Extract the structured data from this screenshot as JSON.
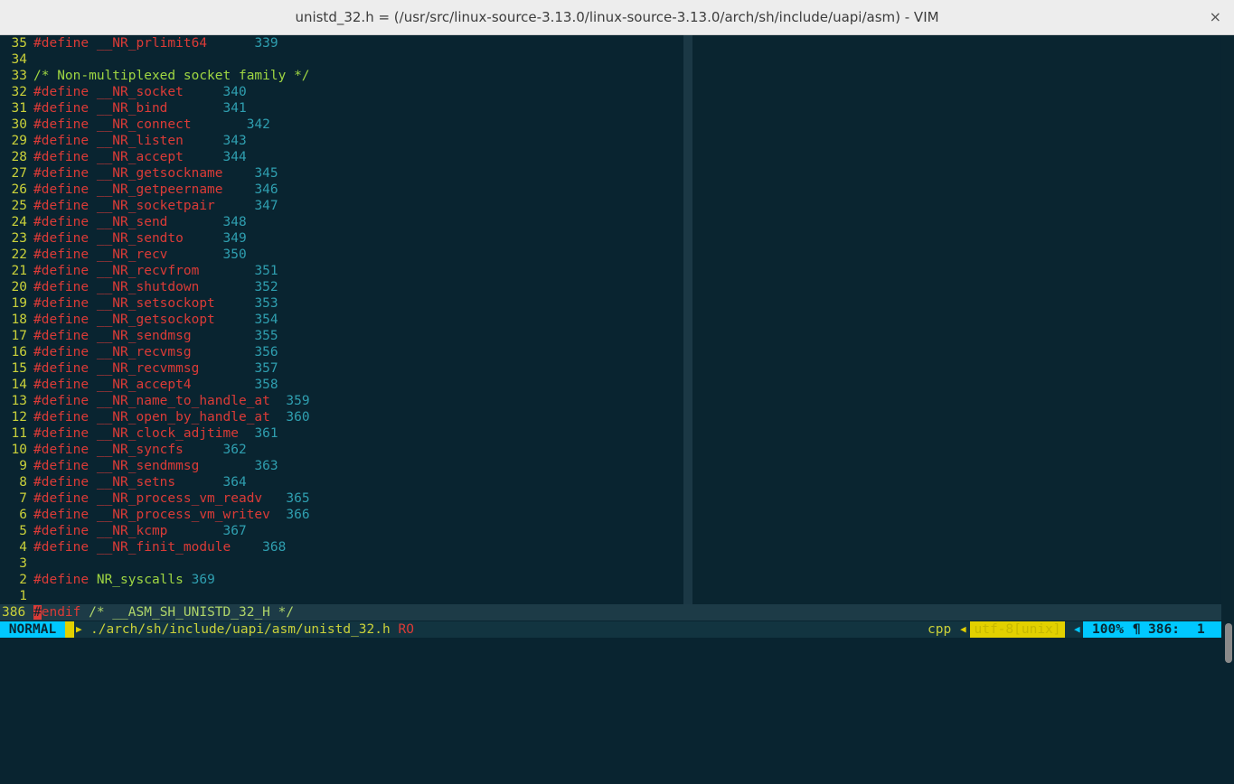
{
  "window": {
    "title": "unistd_32.h = (/usr/src/linux-source-3.13.0/linux-source-3.13.0/arch/sh/include/uapi/asm) - VIM",
    "close_glyph": "×"
  },
  "editor": {
    "lines": [
      {
        "ln": "35",
        "kw": "#define __NR_prlimit64",
        "pad": "      ",
        "num": "339"
      },
      {
        "ln": "34",
        "blank": true
      },
      {
        "ln": "33",
        "comment": "/* Non-multiplexed socket family */"
      },
      {
        "ln": "32",
        "kw": "#define __NR_socket",
        "pad": "     ",
        "num": "340"
      },
      {
        "ln": "31",
        "kw": "#define __NR_bind",
        "pad": "       ",
        "num": "341"
      },
      {
        "ln": "30",
        "kw": "#define __NR_connect",
        "pad": "       ",
        "num": "342"
      },
      {
        "ln": "29",
        "kw": "#define __NR_listen",
        "pad": "     ",
        "num": "343"
      },
      {
        "ln": "28",
        "kw": "#define __NR_accept",
        "pad": "     ",
        "num": "344"
      },
      {
        "ln": "27",
        "kw": "#define __NR_getsockname",
        "pad": "    ",
        "num": "345"
      },
      {
        "ln": "26",
        "kw": "#define __NR_getpeername",
        "pad": "    ",
        "num": "346"
      },
      {
        "ln": "25",
        "kw": "#define __NR_socketpair",
        "pad": "     ",
        "num": "347"
      },
      {
        "ln": "24",
        "kw": "#define __NR_send",
        "pad": "       ",
        "num": "348"
      },
      {
        "ln": "23",
        "kw": "#define __NR_sendto",
        "pad": "     ",
        "num": "349"
      },
      {
        "ln": "22",
        "kw": "#define __NR_recv",
        "pad": "       ",
        "num": "350"
      },
      {
        "ln": "21",
        "kw": "#define __NR_recvfrom",
        "pad": "       ",
        "num": "351"
      },
      {
        "ln": "20",
        "kw": "#define __NR_shutdown",
        "pad": "       ",
        "num": "352"
      },
      {
        "ln": "19",
        "kw": "#define __NR_setsockopt",
        "pad": "     ",
        "num": "353"
      },
      {
        "ln": "18",
        "kw": "#define __NR_getsockopt",
        "pad": "     ",
        "num": "354"
      },
      {
        "ln": "17",
        "kw": "#define __NR_sendmsg",
        "pad": "        ",
        "num": "355"
      },
      {
        "ln": "16",
        "kw": "#define __NR_recvmsg",
        "pad": "        ",
        "num": "356"
      },
      {
        "ln": "15",
        "kw": "#define __NR_recvmmsg",
        "pad": "       ",
        "num": "357"
      },
      {
        "ln": "14",
        "kw": "#define __NR_accept4",
        "pad": "        ",
        "num": "358"
      },
      {
        "ln": "13",
        "kw": "#define __NR_name_to_handle_at",
        "pad": "  ",
        "num": "359"
      },
      {
        "ln": "12",
        "kw": "#define __NR_open_by_handle_at",
        "pad": "  ",
        "num": "360"
      },
      {
        "ln": "11",
        "kw": "#define __NR_clock_adjtime",
        "pad": "  ",
        "num": "361"
      },
      {
        "ln": "10",
        "kw": "#define __NR_syncfs",
        "pad": "     ",
        "num": "362"
      },
      {
        "ln": "9",
        "kw": "#define __NR_sendmmsg",
        "pad": "       ",
        "num": "363"
      },
      {
        "ln": "8",
        "kw": "#define __NR_setns",
        "pad": "      ",
        "num": "364"
      },
      {
        "ln": "7",
        "kw": "#define __NR_process_vm_readv",
        "pad": "   ",
        "num": "365"
      },
      {
        "ln": "6",
        "kw": "#define __NR_process_vm_writev",
        "pad": "  ",
        "num": "366"
      },
      {
        "ln": "5",
        "kw": "#define __NR_kcmp",
        "pad": "       ",
        "num": "367"
      },
      {
        "ln": "4",
        "kw": "#define __NR_finit_module",
        "pad": "    ",
        "num": "368"
      },
      {
        "ln": "3",
        "blank": true
      },
      {
        "ln": "2",
        "kw": "#define",
        "plain": " NR_syscalls ",
        "num": "369"
      },
      {
        "ln": "1",
        "blank": true
      }
    ],
    "current_line": {
      "ln": "386",
      "cursor_char": "#",
      "directive": "endif",
      "comment": " /* __ASM_SH_UNISTD_32_H */"
    }
  },
  "statusline": {
    "mode": "NORMAL",
    "filepath": "./arch/sh/include/uapi/asm/unistd_32.h",
    "readonly": "RO",
    "filetype": "cpp",
    "encoding": "utf-8[unix]",
    "percent": "100%",
    "pilcrow": "¶",
    "line": "386:",
    "col": "1"
  }
}
